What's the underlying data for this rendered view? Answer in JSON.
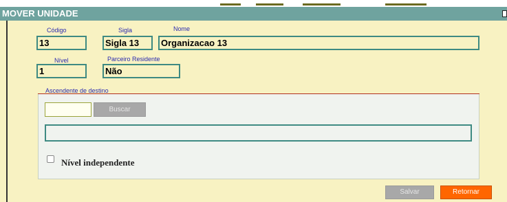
{
  "dialog": {
    "title": "MOVER UNIDADE"
  },
  "fields": {
    "codigo": {
      "label": "Código",
      "value": "13"
    },
    "sigla": {
      "label": "Sigla",
      "value": "Sigla 13"
    },
    "nome": {
      "label": "Nome",
      "value": "Organizacao 13"
    },
    "nivel": {
      "label": "Nível",
      "value": "1"
    },
    "parceiro_residente": {
      "label": "Parceiro Residente",
      "value": "Não"
    }
  },
  "destino": {
    "section_label": "Ascendente de destino",
    "search_value": "",
    "search_button": "Buscar",
    "selected_value": "",
    "independente_label": "Nível independente",
    "independente_checked": false
  },
  "actions": {
    "save_label": "Salvar",
    "return_label": "Retornar"
  }
}
